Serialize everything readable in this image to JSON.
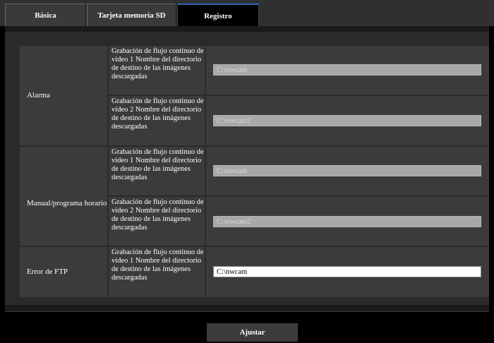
{
  "tabs": [
    {
      "label": "Básica"
    },
    {
      "label": "Tarjeta memoria SD"
    },
    {
      "label": "Registro"
    }
  ],
  "groups": {
    "alarm": {
      "label": "Alarma",
      "rows": [
        {
          "desc": "Grabación de flujo continuo de vídeo 1 Nombre del directorio de destino de las imágenes descargadas",
          "value": "C:\\nwcam",
          "enabled": false
        },
        {
          "desc": "Grabación de flujo continuo de vídeo 2 Nombre del directorio de destino de las imágenes descargadas",
          "value": "C:\\nwcam2",
          "enabled": false
        }
      ]
    },
    "manual": {
      "label": "Manual/programa horario",
      "rows": [
        {
          "desc": "Grabación de flujo continuo de vídeo 1 Nombre del directorio de destino de las imágenes descargadas",
          "value": "C:\\nwcam",
          "enabled": false
        },
        {
          "desc": "Grabación de flujo continuo de vídeo 2 Nombre del directorio de destino de las imágenes descargadas",
          "value": "C:\\nwcam2",
          "enabled": false
        }
      ]
    },
    "ftp": {
      "label": "Error de FTP",
      "rows": [
        {
          "desc": "Grabación de flujo continuo de vídeo 1 Nombre del directorio de destino de las imágenes descargadas",
          "value": "C:\\nwcam",
          "enabled": true
        }
      ]
    }
  },
  "submit_label": "Ajustar"
}
